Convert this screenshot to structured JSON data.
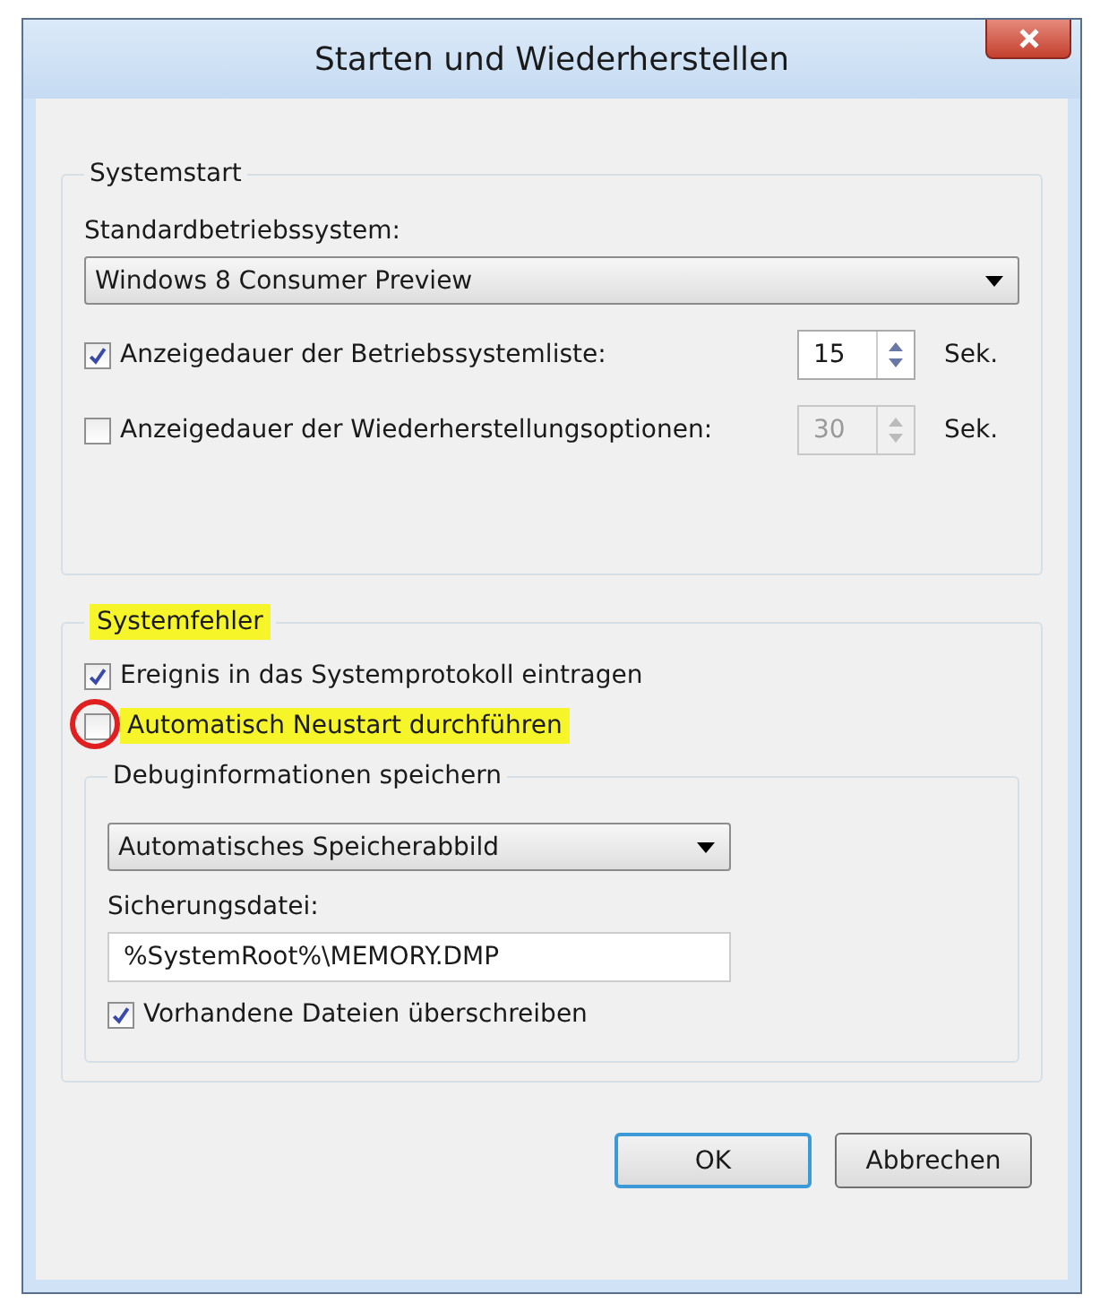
{
  "window": {
    "title": "Starten und Wiederherstellen"
  },
  "systemstart": {
    "title": "Systemstart",
    "default_os_label": "Standardbetriebssystem:",
    "default_os_value": "Windows 8 Consumer Preview",
    "rows": [
      {
        "label": "Anzeigedauer der Betriebssystemliste:",
        "checked": true,
        "value": "15",
        "unit": "Sek.",
        "disabled": false
      },
      {
        "label": "Anzeigedauer der Wiederherstellungsoptionen:",
        "checked": false,
        "value": "30",
        "unit": "Sek.",
        "disabled": true
      }
    ]
  },
  "systemfehler": {
    "title": "Systemfehler",
    "title_highlighted": true,
    "options": [
      {
        "label": "Ereignis in das Systemprotokoll eintragen",
        "checked": true,
        "highlighted": false,
        "circled": false
      },
      {
        "label": "Automatisch Neustart durchführen",
        "checked": false,
        "highlighted": true,
        "circled": true
      }
    ],
    "debug": {
      "title": "Debuginformationen speichern",
      "dropdown_value": "Automatisches Speicherabbild",
      "file_label": "Sicherungsdatei:",
      "file_value": "%SystemRoot%\\MEMORY.DMP",
      "overwrite": {
        "label": "Vorhandene Dateien überschreiben",
        "checked": true
      }
    }
  },
  "buttons": [
    {
      "label": "OK",
      "default": true
    },
    {
      "label": "Abbrechen",
      "default": false
    }
  ]
}
